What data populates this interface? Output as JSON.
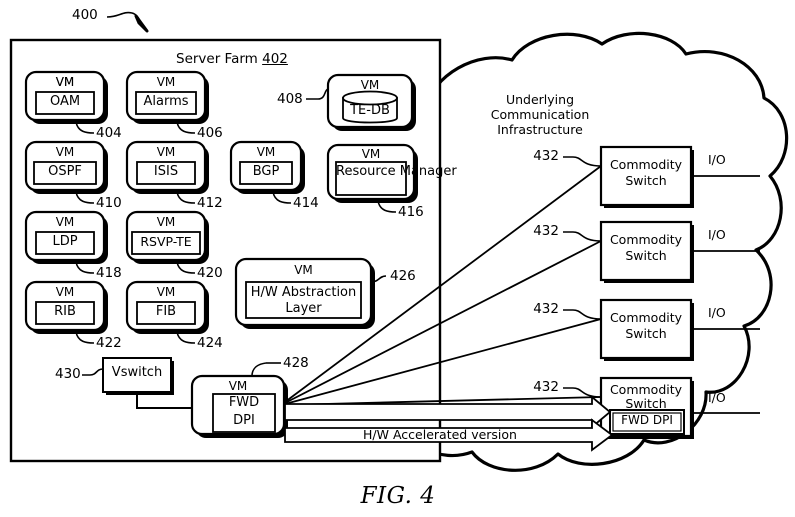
{
  "figure": {
    "caption": "FIG. 4",
    "figure_ref": "400"
  },
  "server_farm": {
    "title": "Server Farm",
    "ref": "402",
    "vm_label": "VM",
    "vms": [
      {
        "name": "OAM",
        "ref": "404",
        "shape": "rect",
        "col": 0,
        "row": 0
      },
      {
        "name": "Alarms",
        "ref": "406",
        "shape": "rect",
        "col": 1,
        "row": 0
      },
      {
        "name": "TE-DB",
        "ref": "408",
        "shape": "cylinder",
        "col": 3,
        "row": 0
      },
      {
        "name": "OSPF",
        "ref": "410",
        "shape": "rect",
        "col": 0,
        "row": 1
      },
      {
        "name": "ISIS",
        "ref": "412",
        "shape": "rect",
        "col": 1,
        "row": 1
      },
      {
        "name": "BGP",
        "ref": "414",
        "shape": "rect",
        "col": 2,
        "row": 1
      },
      {
        "name": "Resource Manager",
        "ref": "416",
        "shape": "rect",
        "col": 3,
        "row": 1
      },
      {
        "name": "LDP",
        "ref": "418",
        "shape": "rect",
        "col": 0,
        "row": 2
      },
      {
        "name": "RSVP-TE",
        "ref": "420",
        "shape": "rect",
        "col": 1,
        "row": 2
      },
      {
        "name": "RIB",
        "ref": "422",
        "shape": "rect",
        "col": 0,
        "row": 3
      },
      {
        "name": "FIB",
        "ref": "424",
        "shape": "rect",
        "col": 1,
        "row": 3
      },
      {
        "name": "H/W Abstraction Layer",
        "ref": "426",
        "shape": "rect",
        "col": 2,
        "row": 3
      }
    ],
    "hw_abstraction": {
      "vm_label": "VM",
      "line1": "H/W Abstraction",
      "line2": "Layer",
      "ref": "426"
    },
    "vswitch": {
      "label": "Vswitch",
      "ref": "430"
    },
    "fwd_vm": {
      "vm_label": "VM",
      "line1": "FWD",
      "line2": "DPI",
      "ref": "428"
    }
  },
  "cloud": {
    "title_line1": "Underlying",
    "title_line2": "Communication",
    "title_line3": "Infrastructure",
    "switches": [
      {
        "line1": "Commodity",
        "line2": "Switch",
        "ref": "432",
        "io": "I/O",
        "has_fwd_dpi": false
      },
      {
        "line1": "Commodity",
        "line2": "Switch",
        "ref": "432",
        "io": "I/O",
        "has_fwd_dpi": false
      },
      {
        "line1": "Commodity",
        "line2": "Switch",
        "ref": "432",
        "io": "I/O",
        "has_fwd_dpi": false
      },
      {
        "line1": "Commodity",
        "line2": "Switch",
        "ref": "432",
        "io": "I/O",
        "has_fwd_dpi": true
      }
    ],
    "fwd_dpi_label": "FWD DPI"
  },
  "connections": {
    "accelerated_label": "H/W Accelerated version"
  },
  "colors": {
    "stroke": "#000000",
    "fill": "#ffffff",
    "background": "#ffffff"
  }
}
